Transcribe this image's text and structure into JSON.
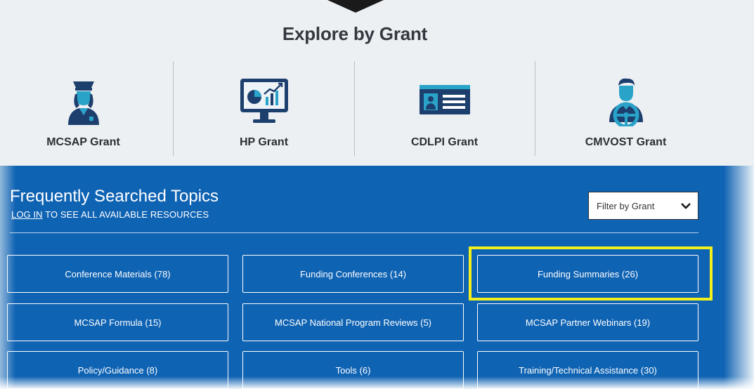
{
  "explore": {
    "title": "Explore by Grant",
    "grants": [
      {
        "label": "MCSAP Grant",
        "icon": "officer-icon"
      },
      {
        "label": "HP Grant",
        "icon": "monitor-chart-icon"
      },
      {
        "label": "CDLPI Grant",
        "icon": "id-card-icon"
      },
      {
        "label": "CMVOST Grant",
        "icon": "driver-icon"
      }
    ]
  },
  "topics_section": {
    "title": "Frequently Searched Topics",
    "login_link": "LOG IN",
    "login_suffix": " TO SEE ALL AVAILABLE RESOURCES",
    "filter_label": "Filter by Grant",
    "topics": [
      "Conference Materials (78)",
      "Funding Conferences (14)",
      "Funding Summaries (26)",
      "MCSAP Formula (15)",
      "MCSAP National Program Reviews (5)",
      "MCSAP Partner Webinars (19)",
      "Policy/Guidance (8)",
      "Tools (6)",
      "Training/Technical Assistance (30)"
    ],
    "highlighted_topic": "Funding Summaries (26)"
  },
  "colors": {
    "accent_blue": "#0f63b3",
    "icon_navy": "#1d3f6e",
    "icon_teal": "#2aa3c9",
    "highlight": "#f2f01c",
    "band_grey": "#edf0f3"
  }
}
